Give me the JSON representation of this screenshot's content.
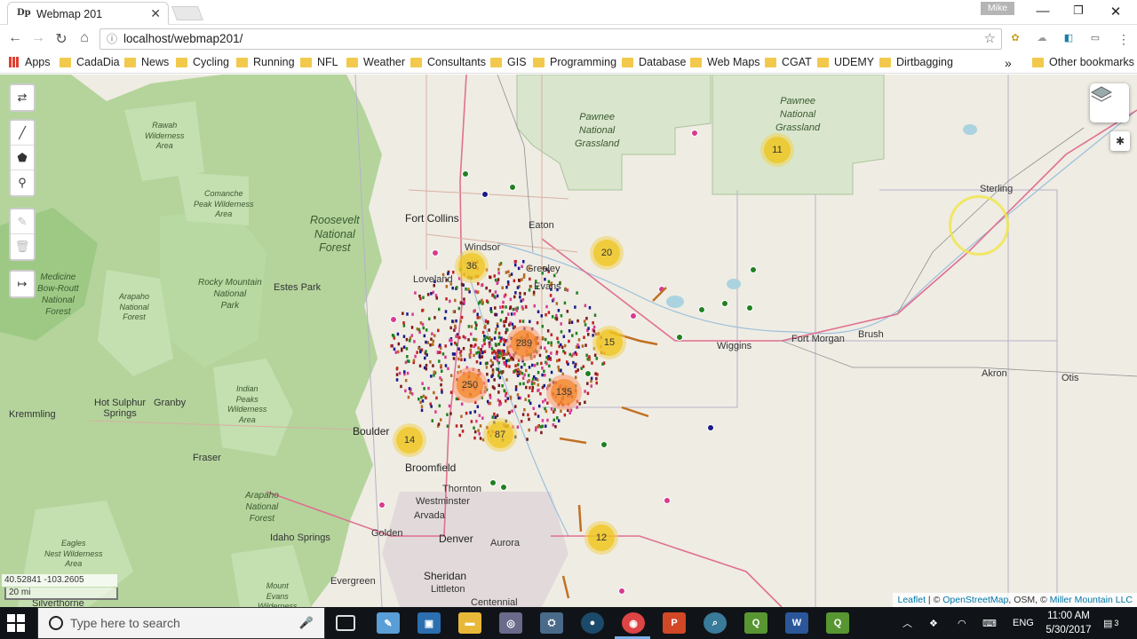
{
  "browser": {
    "tab_title": "Webmap 201",
    "tab_favicon": "Dp",
    "user_name": "Mike",
    "url": "localhost/webmap201/"
  },
  "bookmarks": {
    "apps_label": "Apps",
    "items": [
      "CadaDia",
      "News",
      "Cycling",
      "Running",
      "NFL",
      "Weather",
      "Consultants",
      "GIS",
      "Programming",
      "Database",
      "Web Maps",
      "CGAT",
      "UDEMY",
      "Dirtbagging"
    ],
    "more": "»",
    "other": "Other bookmarks"
  },
  "map": {
    "areas": {
      "roosevelt": "Roosevelt\nNational\nForest",
      "rmnp": "Rocky Mountain\nNational\nPark",
      "arapaho_nf_north": "Arapaho\nNational\nForest",
      "arapaho_nf_south": "Arapaho\nNational\nForest",
      "medicine_bow": "Medicine\nBow-Routt\nNational\nForest",
      "rawah": "Rawah\nWilderness\nArea",
      "comanche": "Comanche\nPeak Wilderness\nArea",
      "indian_peaks": "Indian\nPeaks\nWilderness\nArea",
      "eagles_nest": "Eagles\nNest Wilderness\nArea",
      "mount_evans": "Mount\nEvans\nWilderness",
      "pawnee_west": "Pawnee\nNational\nGrassland",
      "pawnee_east": "Pawnee\nNational\nGrassland"
    },
    "towns": {
      "fort_collins": "Fort Collins",
      "eaton": "Eaton",
      "windsor": "Windsor",
      "greeley": "Greeley",
      "loveland": "Loveland",
      "evans": "Evans",
      "estes_park": "Estes Park",
      "boulder": "Boulder",
      "broomfield": "Broomfield",
      "thornton": "Thornton",
      "westminster": "Westminster",
      "arvada": "Arvada",
      "golden": "Golden",
      "denver": "Denver",
      "aurora": "Aurora",
      "sheridan": "Sheridan",
      "littleton": "Littleton",
      "centennial": "Centennial",
      "evergreen": "Evergreen",
      "idaho_springs": "Idaho Springs",
      "fraser": "Fraser",
      "granby": "Granby",
      "hot_sulphur": "Hot Sulphur\nSprings",
      "kremmling": "Kremmling",
      "silverthorne": "Silverthorne",
      "wiggins": "Wiggins",
      "fort_morgan": "Fort Morgan",
      "brush": "Brush",
      "sterling": "Sterling",
      "akron": "Akron",
      "otis": "Otis"
    },
    "clusters": [
      "11",
      "36",
      "20",
      "289",
      "15",
      "250",
      "135",
      "14",
      "87",
      "12"
    ],
    "coords": "40.52841 -103.2605",
    "scale": "20 mi",
    "attribution": {
      "leaflet": "Leaflet",
      "sep1": " | © ",
      "osm": "OpenStreetMap",
      "mid": ", OSM, © ",
      "mm": "Miller Mountain LLC"
    },
    "icons": {
      "toggle": "swap-arrows-icon",
      "polyline": "polyline-icon",
      "polygon": "polygon-icon",
      "marker": "marker-icon",
      "edit": "edit-icon",
      "delete": "trash-icon",
      "sidebar": "sidebar-toggle-icon",
      "layers": "layers-icon",
      "locate": "locate-icon"
    },
    "colors": {
      "forest": "#a6cf8e",
      "grassland": "#d9e6cd",
      "cluster_yellow": "#f0c20c",
      "cluster_orange": "#f18017"
    }
  },
  "taskbar": {
    "search_placeholder": "Type here to search",
    "language": "ENG",
    "time": "11:00 AM",
    "date": "5/30/2017",
    "notifications": "3"
  }
}
